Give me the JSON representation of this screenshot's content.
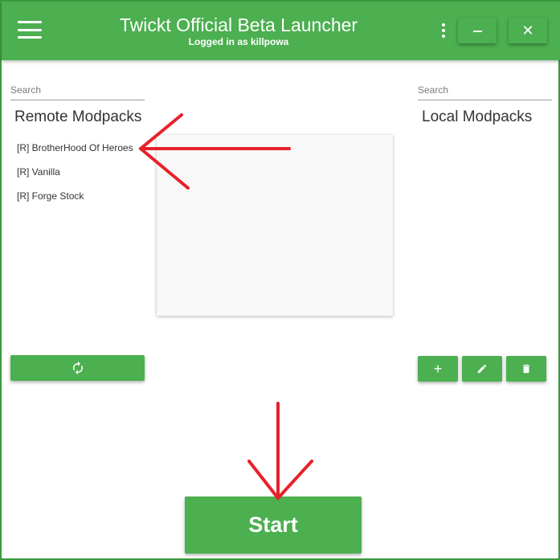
{
  "header": {
    "title": "Twickt Official Beta Launcher",
    "subtitle": "Logged in as killpowa",
    "menu_icon": "hamburger-menu-icon",
    "more_icon": "vertical-dots-icon",
    "minimize_icon": "minimize-icon",
    "close_label": "✕"
  },
  "left": {
    "search_placeholder": "Search",
    "title": "Remote Modpacks",
    "items": [
      "[R] BrotherHood Of Heroes",
      "[R] Vanilla",
      "[R] Forge Stock"
    ],
    "refresh_icon": "refresh-icon"
  },
  "right": {
    "search_placeholder": "Search",
    "title": "Local Modpacks",
    "add_label": "+",
    "edit_icon": "pencil-icon",
    "delete_icon": "trash-icon"
  },
  "footer": {
    "start_label": "Start"
  },
  "colors": {
    "primary": "#4caf50",
    "annotation": "#e8202a"
  }
}
